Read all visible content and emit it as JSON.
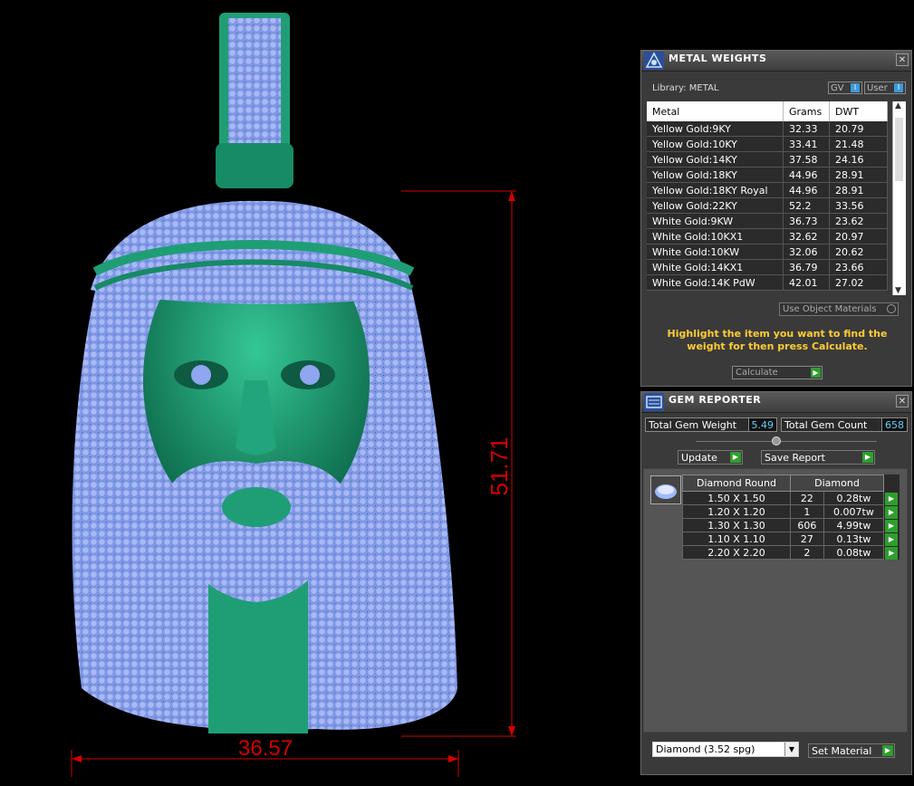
{
  "viewport": {
    "dimension_height": "51.71",
    "dimension_width": "36.57"
  },
  "metal_weights": {
    "title": "METAL WEIGHTS",
    "close": "✕",
    "library_label": "Library: METAL",
    "gv_label": "GV",
    "user_label": "User",
    "columns": [
      "Metal",
      "Grams",
      "DWT"
    ],
    "rows": [
      {
        "metal": "Yellow Gold:9KY",
        "grams": "32.33",
        "dwt": "20.79"
      },
      {
        "metal": "Yellow Gold:10KY",
        "grams": "33.41",
        "dwt": "21.48"
      },
      {
        "metal": "Yellow Gold:14KY",
        "grams": "37.58",
        "dwt": "24.16"
      },
      {
        "metal": "Yellow Gold:18KY",
        "grams": "44.96",
        "dwt": "28.91"
      },
      {
        "metal": "Yellow Gold:18KY Royal",
        "grams": "44.96",
        "dwt": "28.91"
      },
      {
        "metal": "Yellow Gold:22KY",
        "grams": "52.2",
        "dwt": "33.56"
      },
      {
        "metal": "White Gold:9KW",
        "grams": "36.73",
        "dwt": "23.62"
      },
      {
        "metal": "White Gold:10KX1",
        "grams": "32.62",
        "dwt": "20.97"
      },
      {
        "metal": "White Gold:10KW",
        "grams": "32.06",
        "dwt": "20.62"
      },
      {
        "metal": "White Gold:14KX1",
        "grams": "36.79",
        "dwt": "23.66"
      },
      {
        "metal": "White Gold:14K PdW",
        "grams": "42.01",
        "dwt": "27.02"
      }
    ],
    "use_object_materials": "Use Object Materials",
    "hint": "Highlight the item you want to find the weight for then press Calculate.",
    "calculate": "Calculate"
  },
  "gem_reporter": {
    "title": "GEM REPORTER",
    "close": "✕",
    "total_weight_label": "Total Gem Weight",
    "total_weight_value": "5.49",
    "total_count_label": "Total Gem Count",
    "total_count_value": "658",
    "update": "Update",
    "save_report": "Save Report",
    "shape_header": "Diamond Round",
    "material_header": "Diamond",
    "rows": [
      {
        "size": "1.50 X 1.50",
        "count": "22",
        "weight": "0.28tw"
      },
      {
        "size": "1.20 X 1.20",
        "count": "1",
        "weight": "0.007tw"
      },
      {
        "size": "1.30 X 1.30",
        "count": "606",
        "weight": "4.99tw"
      },
      {
        "size": "1.10 X 1.10",
        "count": "27",
        "weight": "0.13tw"
      },
      {
        "size": "2.20 X 2.20",
        "count": "2",
        "weight": "0.08tw"
      }
    ],
    "material_select": "Diamond     (3.52 spg)",
    "set_material": "Set Material"
  },
  "colors": {
    "metal": "#1f9e76",
    "gems": "#8fa6f0",
    "dimension": "#d40000",
    "hint": "#ffcc33",
    "go_button": "#2e9e2e"
  }
}
